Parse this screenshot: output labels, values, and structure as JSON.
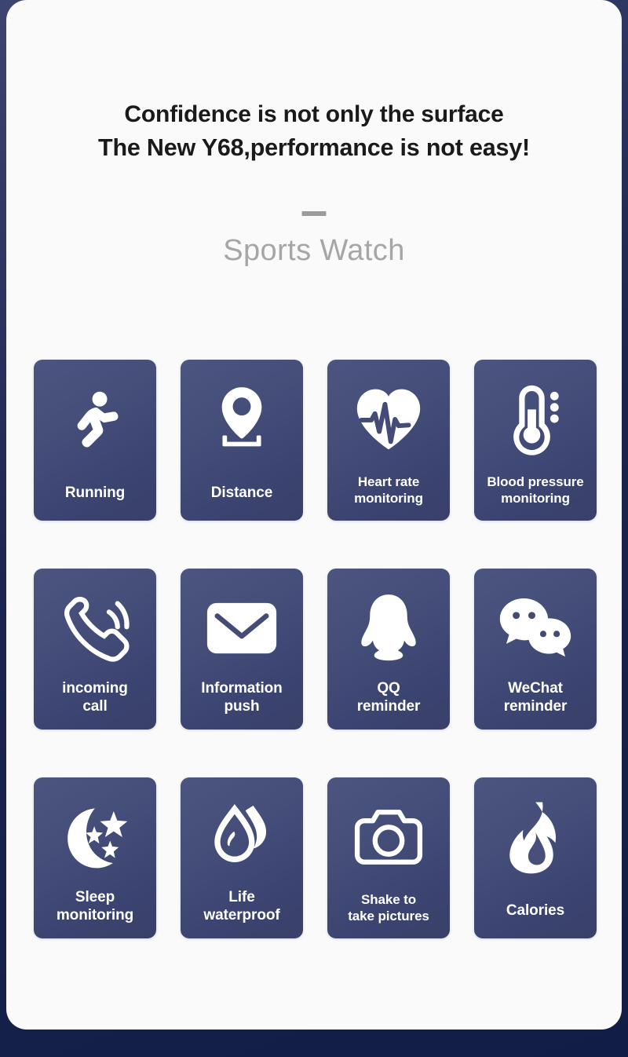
{
  "page": {
    "background_color": "#152148",
    "card_background": "#fafafa",
    "tile_color": "#454d79",
    "label_color": "#ffffff",
    "subtitle_color": "#a6a6a6",
    "headline_color": "#1a1a1a"
  },
  "header": {
    "headline_line1": "Confidence is not only the surface",
    "headline_line2": "The New Y68,performance is not easy!",
    "subtitle": "Sports Watch"
  },
  "features": [
    {
      "label": "Running",
      "label_lines": "Running",
      "icon": "running-person-icon",
      "lines": 1
    },
    {
      "label": "Distance",
      "label_lines": "Distance",
      "icon": "location-pin-icon",
      "lines": 1
    },
    {
      "label": "Heart rate monitoring",
      "label_lines": "Heart rate\nmonitoring",
      "icon": "heart-rate-icon",
      "lines": 2
    },
    {
      "label": "Blood pressure monitoring",
      "label_lines": "Blood pressure\nmonitoring",
      "icon": "thermometer-icon",
      "lines": 2
    },
    {
      "label": "incoming call",
      "label_lines": "incoming\ncall",
      "icon": "phone-call-icon",
      "lines": 2
    },
    {
      "label": "Information push",
      "label_lines": "Information\npush",
      "icon": "envelope-icon",
      "lines": 2
    },
    {
      "label": "QQ reminder",
      "label_lines": "QQ\nreminder",
      "icon": "qq-penguin-icon",
      "lines": 2
    },
    {
      "label": "WeChat reminder",
      "label_lines": "WeChat\nreminder",
      "icon": "wechat-bubbles-icon",
      "lines": 2
    },
    {
      "label": "Sleep monitoring",
      "label_lines": "Sleep\nmonitoring",
      "icon": "moon-stars-icon",
      "lines": 2
    },
    {
      "label": "Life waterproof",
      "label_lines": "Life\nwaterproof",
      "icon": "water-drop-icon",
      "lines": 2
    },
    {
      "label": "Shake to take pictures",
      "label_lines": "Shake to\ntake pictures",
      "icon": "camera-icon",
      "lines": 2
    },
    {
      "label": "Calories",
      "label_lines": "Calories",
      "icon": "flame-icon",
      "lines": 1
    }
  ]
}
